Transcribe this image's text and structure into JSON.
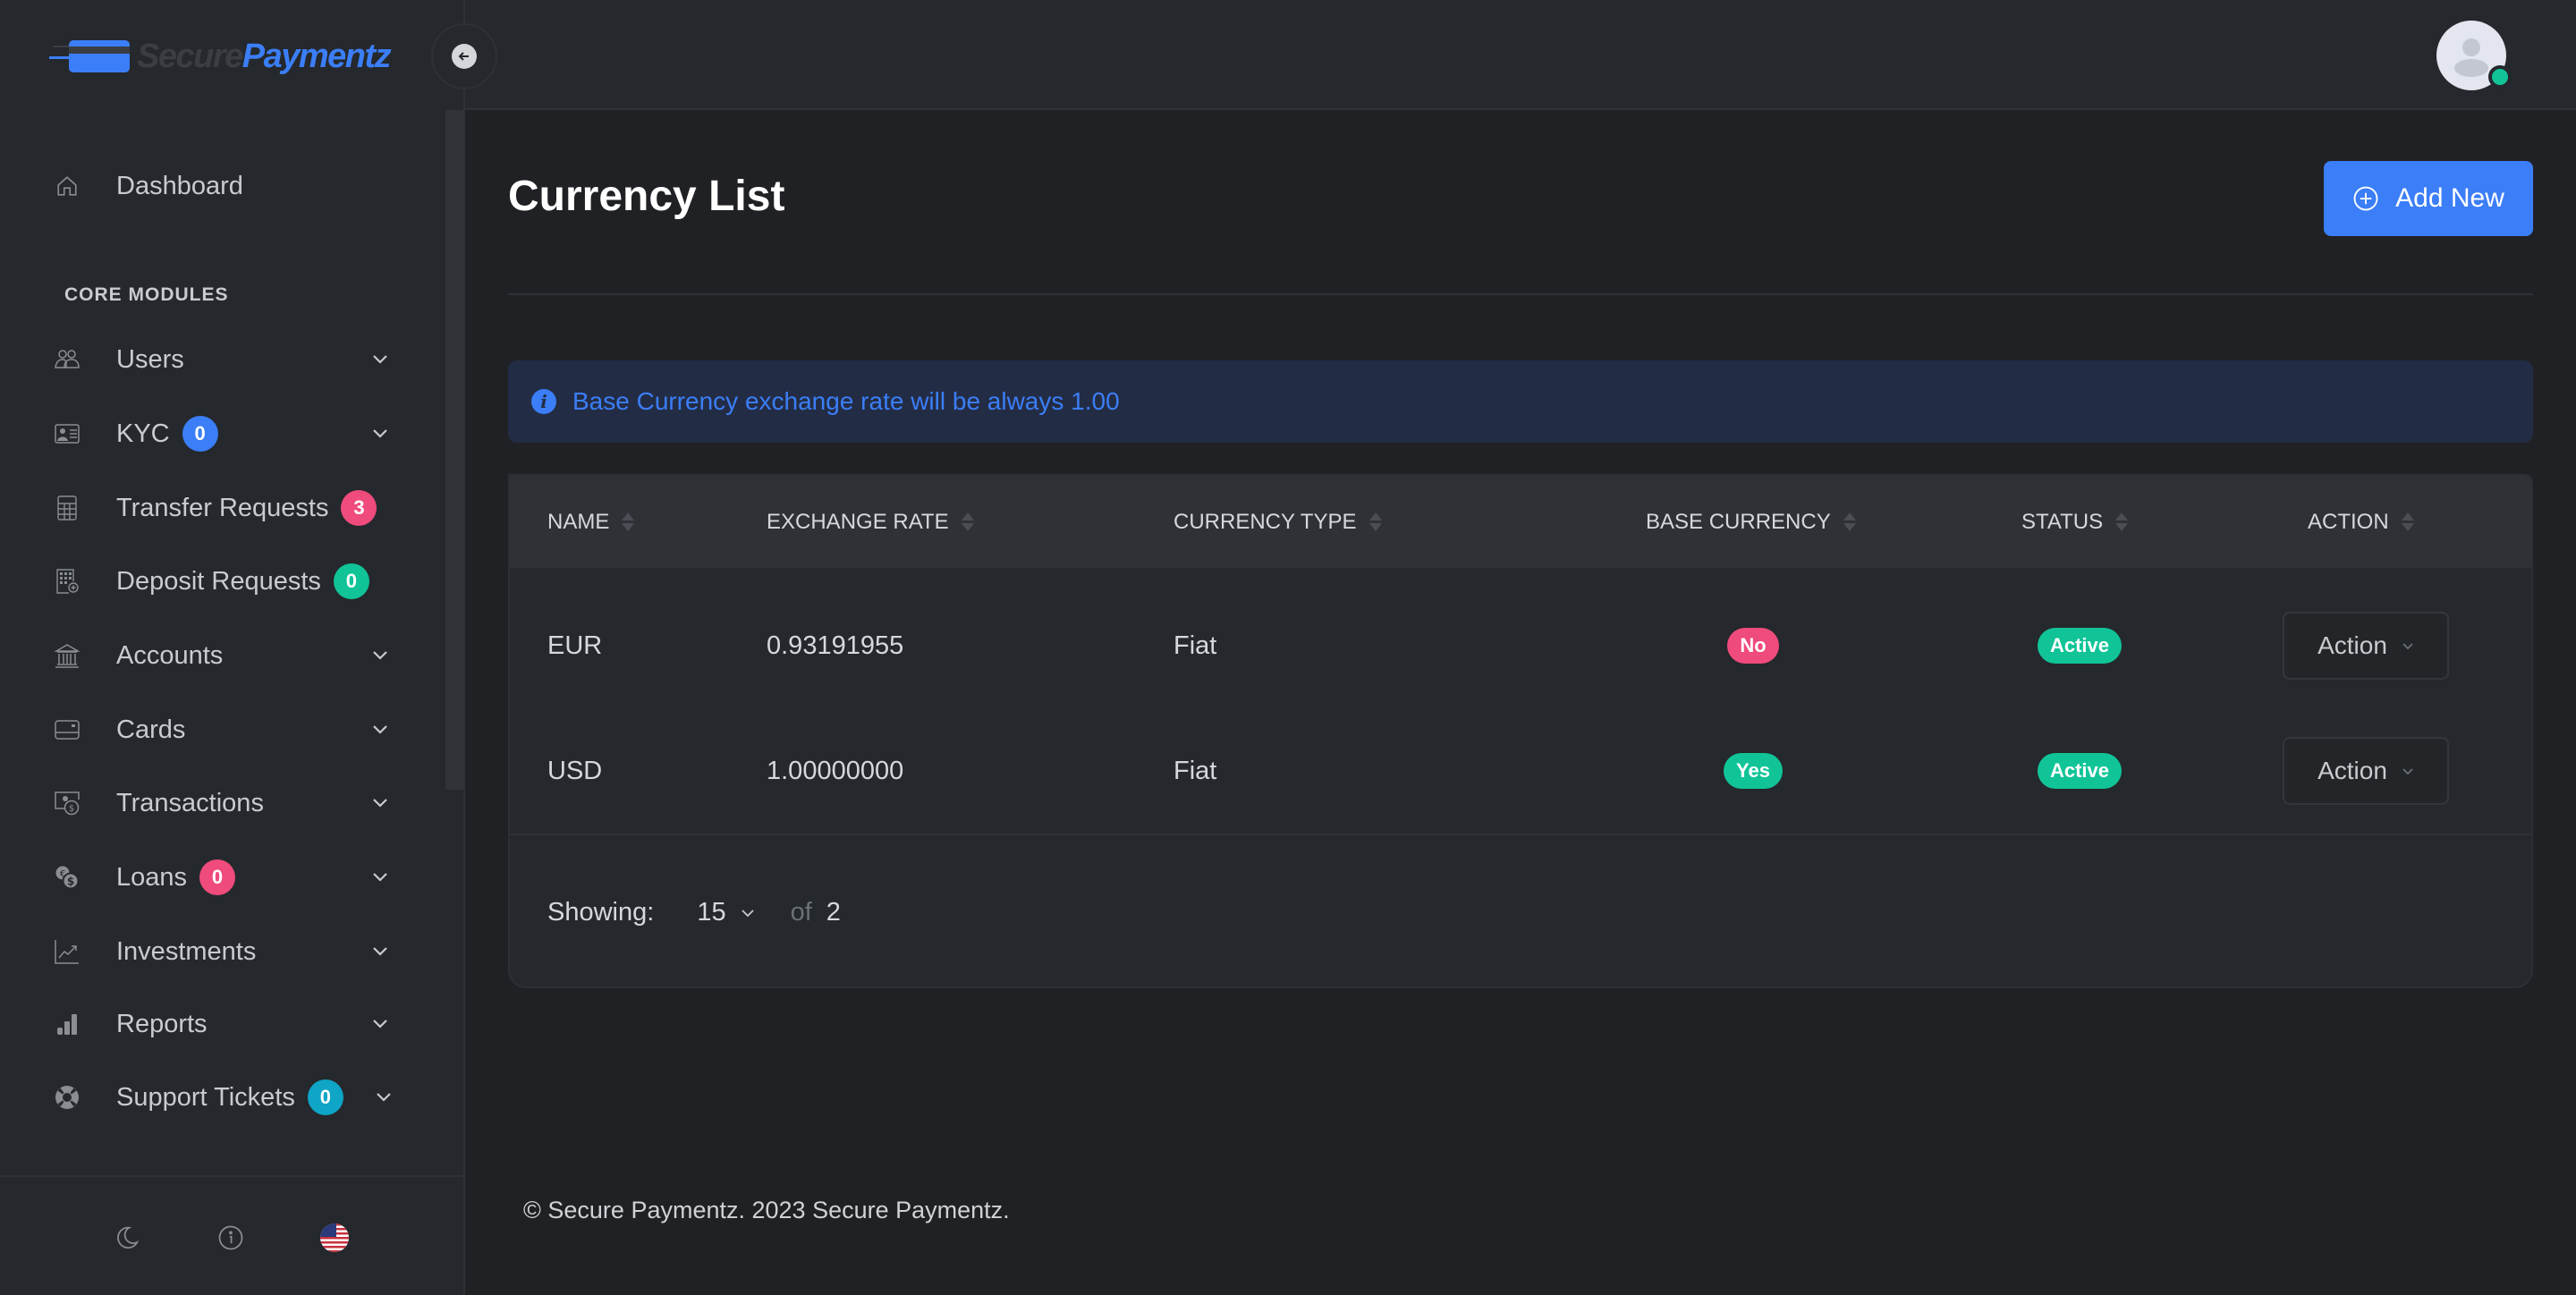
{
  "brand": {
    "name_part1": "Secure",
    "name_part2": "Paymentz"
  },
  "header": {
    "avatar_status": "online"
  },
  "sidebar": {
    "dashboard": {
      "label": "Dashboard",
      "icon": "home-icon"
    },
    "section_label": "CORE MODULES",
    "items": [
      {
        "label": "Users",
        "icon": "users-icon",
        "badge": null,
        "has_chevron": true
      },
      {
        "label": "KYC",
        "icon": "id-card-icon",
        "badge": "0",
        "badge_color": "#3b7ef7",
        "has_chevron": true
      },
      {
        "label": "Transfer Requests",
        "icon": "calculator-icon",
        "badge": "3",
        "badge_color": "#ef4b7d",
        "has_chevron": false
      },
      {
        "label": "Deposit Requests",
        "icon": "building-add-icon",
        "badge": "0",
        "badge_color": "#10c498",
        "has_chevron": false
      },
      {
        "label": "Accounts",
        "icon": "bank-icon",
        "badge": null,
        "has_chevron": true
      },
      {
        "label": "Cards",
        "icon": "credit-card-icon",
        "badge": null,
        "has_chevron": true
      },
      {
        "label": "Transactions",
        "icon": "cash-exchange-icon",
        "badge": null,
        "has_chevron": true
      },
      {
        "label": "Loans",
        "icon": "coins-icon",
        "badge": "0",
        "badge_color": "#ef4b7d",
        "has_chevron": true
      },
      {
        "label": "Investments",
        "icon": "chart-line-icon",
        "badge": null,
        "has_chevron": true
      },
      {
        "label": "Reports",
        "icon": "bar-chart-icon",
        "badge": null,
        "has_chevron": true
      },
      {
        "label": "Support Tickets",
        "icon": "lifebuoy-icon",
        "badge": "0",
        "badge_color": "#0ea5c6",
        "has_chevron": true
      }
    ],
    "footer_icons": [
      "moon-icon",
      "info-icon",
      "us-flag-icon"
    ]
  },
  "main": {
    "title": "Currency List",
    "add_button": "Add New",
    "alert": "Base Currency exchange rate will be always 1.00",
    "table": {
      "columns": [
        "NAME",
        "EXCHANGE RATE",
        "CURRENCY TYPE",
        "BASE CURRENCY",
        "STATUS",
        "ACTION"
      ],
      "rows": [
        {
          "name": "EUR",
          "exchange_rate": "0.93191955",
          "currency_type": "Fiat",
          "base_currency": "No",
          "base_color": "#ef4b7d",
          "status": "Active",
          "status_color": "#10c498",
          "action": "Action"
        },
        {
          "name": "USD",
          "exchange_rate": "1.00000000",
          "currency_type": "Fiat",
          "base_currency": "Yes",
          "base_color": "#10c498",
          "status": "Active",
          "status_color": "#10c498",
          "action": "Action"
        }
      ]
    },
    "pagination": {
      "label": "Showing:",
      "per_page": "15",
      "of_label": "of",
      "total": "2"
    }
  },
  "footer": {
    "copyright": "© Secure Paymentz. 2023 Secure Paymentz."
  },
  "colors": {
    "accent": "#3b7ef7",
    "danger": "#ef4b7d",
    "success": "#10c498",
    "info": "#0ea5c6"
  }
}
